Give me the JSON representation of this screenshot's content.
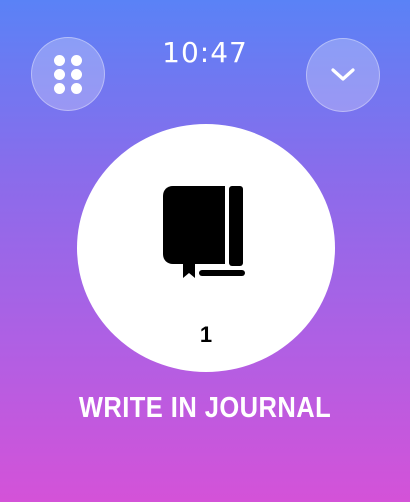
{
  "status": {
    "time": "10:47"
  },
  "controls": {
    "menu_icon": "grid-dots-icon",
    "collapse_icon": "chevron-down-icon"
  },
  "journal": {
    "icon": "book-icon",
    "count": "1",
    "action_label": "WRITE IN JOURNAL"
  },
  "colors": {
    "background_top": "#5a82f6",
    "background_bottom": "#d452d8",
    "circle": "#ffffff",
    "icon": "#000000"
  }
}
